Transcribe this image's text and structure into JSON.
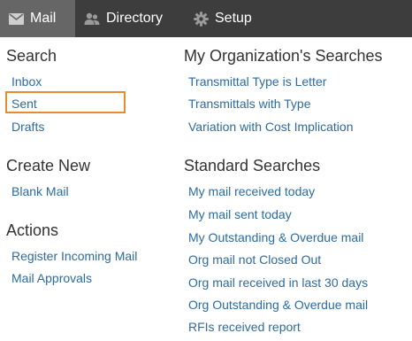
{
  "nav": {
    "tabs": [
      {
        "label": "Mail",
        "icon": "mail-icon",
        "active": true
      },
      {
        "label": "Directory",
        "icon": "people-icon",
        "active": false
      },
      {
        "label": "Setup",
        "icon": "gear-icon",
        "active": false
      }
    ]
  },
  "left": {
    "search": {
      "heading": "Search",
      "items": [
        "Inbox",
        "Sent",
        "Drafts"
      ]
    },
    "create_new": {
      "heading": "Create New",
      "items": [
        "Blank Mail"
      ]
    },
    "actions": {
      "heading": "Actions",
      "items": [
        "Register Incoming Mail",
        "Mail Approvals"
      ]
    }
  },
  "right": {
    "org_searches": {
      "heading": "My Organization's Searches",
      "items": [
        "Transmittal Type is Letter",
        "Transmittals with Type",
        "Variation with Cost Implication"
      ]
    },
    "standard_searches": {
      "heading": "Standard Searches",
      "items": [
        "My mail received today",
        "My mail sent today",
        "My Outstanding & Overdue mail",
        "Org mail not Closed Out",
        "Org mail received in last 30 days",
        "Org Outstanding & Overdue mail",
        "RFIs received report"
      ]
    }
  },
  "colors": {
    "navbar": "#3d3d3d",
    "active_tab": "#666666",
    "link": "#2c6ba0",
    "heading": "#333333",
    "highlight": "#e88a2e"
  }
}
